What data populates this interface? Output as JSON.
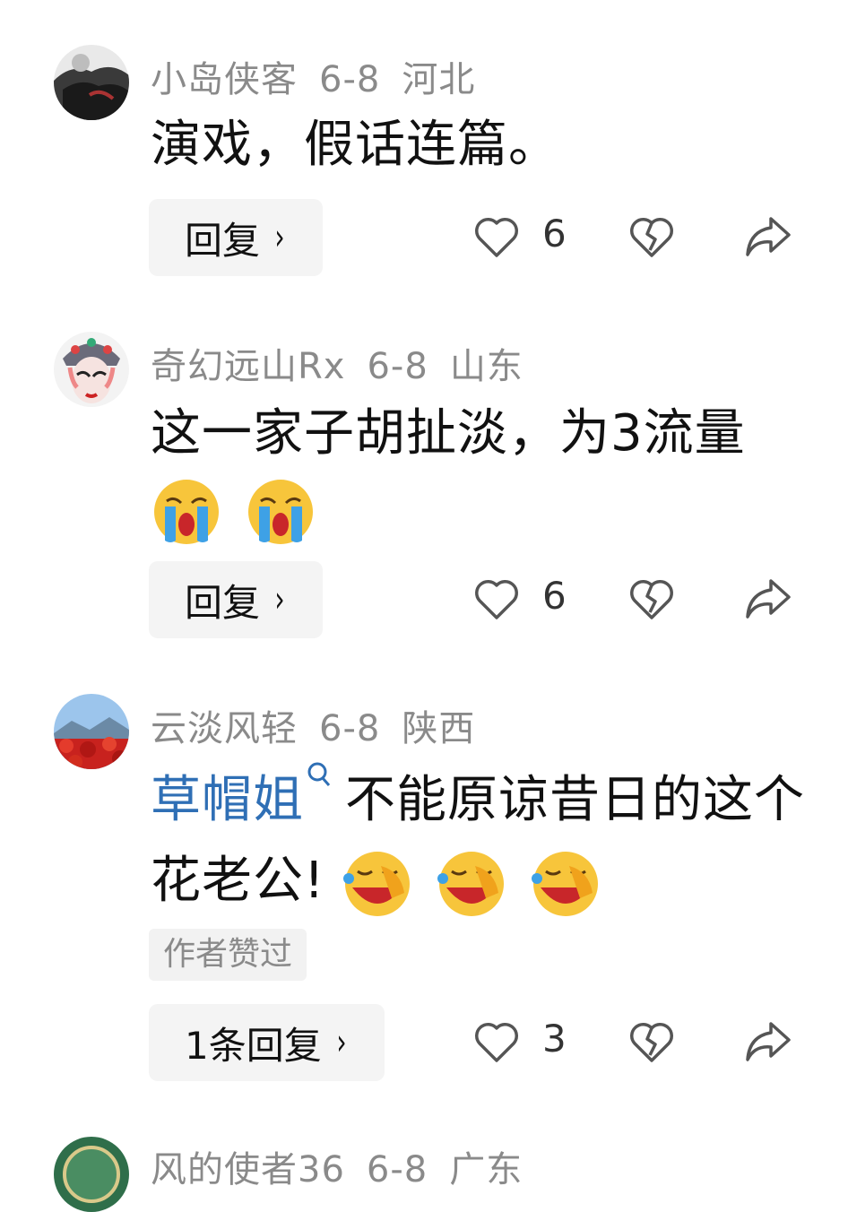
{
  "comments": [
    {
      "username": "小岛侠客",
      "date": "6-8",
      "location": "河北",
      "text": "演戏，假话连篇。",
      "reply_label": "回复",
      "likes": "6"
    },
    {
      "username": "奇幻远山Rx",
      "date": "6-8",
      "location": "山东",
      "text": "这一家子胡扯淡，为3流量",
      "emojis": [
        "crying-emoji",
        "crying-emoji"
      ],
      "reply_label": "回复",
      "likes": "6"
    },
    {
      "username": "云淡风轻",
      "date": "6-8",
      "location": "陕西",
      "mention": "草帽姐",
      "text": "不能原谅昔日的这个花老公!",
      "emojis": [
        "laughing-crying-emoji",
        "laughing-crying-emoji",
        "laughing-crying-emoji"
      ],
      "badge": "作者赞过",
      "reply_label": "1条回复",
      "likes": "3"
    },
    {
      "username": "风的使者36",
      "date": "6-8",
      "location": "广东"
    }
  ],
  "colors": {
    "mention": "#2f6fb5",
    "meta": "#8a8a8a",
    "button_bg": "#f4f4f4"
  },
  "icons": [
    "heart-icon",
    "broken-heart-icon",
    "share-icon",
    "chevron-right-icon",
    "search-icon"
  ]
}
